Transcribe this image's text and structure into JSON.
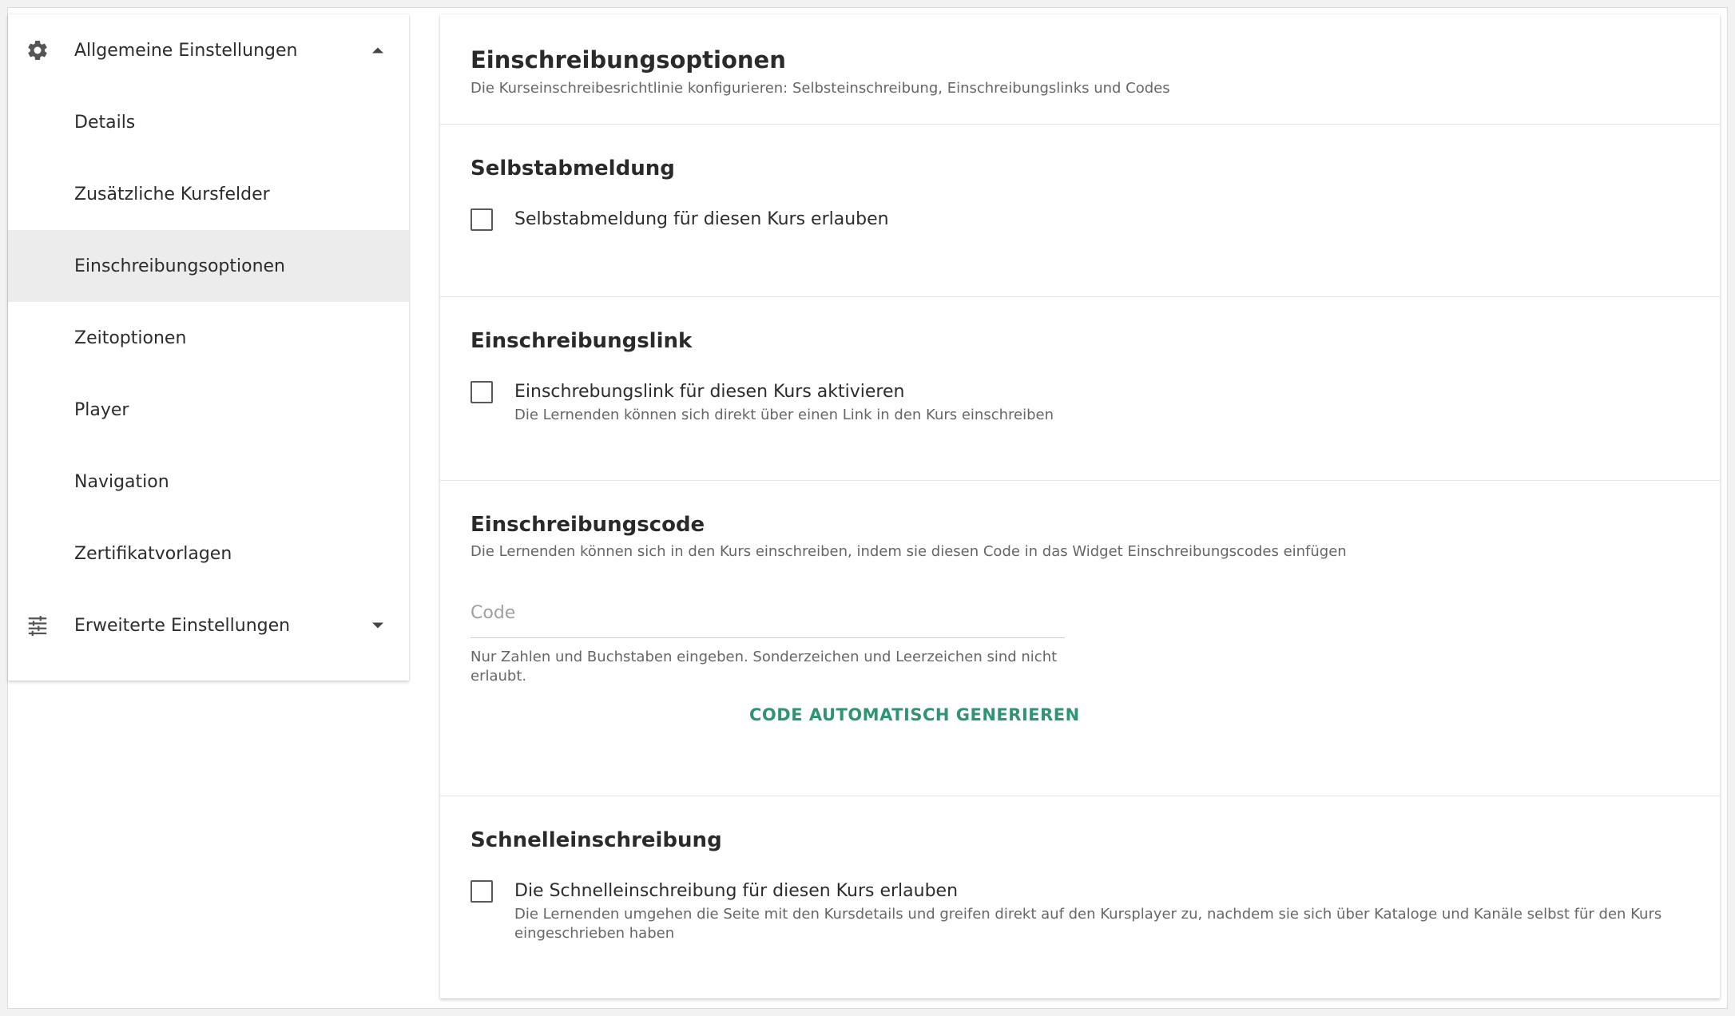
{
  "sidebar": {
    "groups": [
      {
        "label": "Allgemeine Einstellungen",
        "icon": "gear-icon",
        "expanded": true
      },
      {
        "label": "Erweiterte Einstellungen",
        "icon": "sliders-icon",
        "expanded": false
      }
    ],
    "items": [
      {
        "label": "Details"
      },
      {
        "label": "Zusätzliche Kursfelder"
      },
      {
        "label": "Einschreibungsoptionen",
        "active": true
      },
      {
        "label": "Zeitoptionen"
      },
      {
        "label": "Player"
      },
      {
        "label": "Navigation"
      },
      {
        "label": "Zertifikatvorlagen"
      }
    ]
  },
  "header": {
    "title": "Einschreibungsoptionen",
    "subtitle": "Die Kurseinschreibesrichtlinie konfigurieren: Selbsteinschreibung, Einschreibungslinks und Codes"
  },
  "self_unenroll": {
    "title": "Selbstabmeldung",
    "checkbox_label": "Selbstabmeldung für diesen Kurs erlauben",
    "checked": false
  },
  "enroll_link": {
    "title": "Einschreibungslink",
    "checkbox_label": "Einschrebungslink für diesen Kurs aktivieren",
    "help": "Die Lernenden können sich direkt über einen Link in den Kurs einschreiben",
    "checked": false
  },
  "enroll_code": {
    "title": "Einschreibungscode",
    "description": "Die Lernenden können sich in den Kurs einschreiben, indem sie diesen Code in das Widget Einschreibungscodes einfügen",
    "field_value": "",
    "field_placeholder": "Code",
    "field_help": "Nur Zahlen und Buchstaben eingeben. Sonderzeichen und Leerzeichen sind nicht erlaubt.",
    "generate_label": "CODE AUTOMATISCH GENERIEREN"
  },
  "quick_enroll": {
    "title": "Schnelleinschreibung",
    "checkbox_label": "Die Schnelleinschreibung für diesen Kurs erlauben",
    "help": "Die Lernenden umgehen die Seite mit den Kursdetails und greifen direkt auf den Kursplayer zu, nachdem sie sich über Kataloge und Kanäle selbst für den Kurs eingeschrieben haben",
    "checked": false
  },
  "colors": {
    "accent": "#2f9470",
    "active_bg": "#ececec"
  }
}
